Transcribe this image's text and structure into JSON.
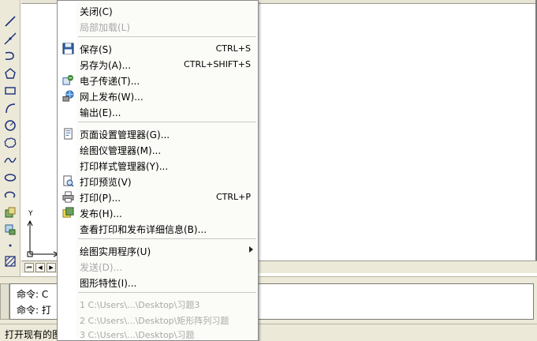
{
  "menu": {
    "items": [
      {
        "label": "关闭(C)",
        "shortcut": "",
        "icon": "",
        "disabled": false
      },
      {
        "label": "局部加载(L)",
        "shortcut": "",
        "icon": "",
        "disabled": true
      },
      {
        "label": "保存(S)",
        "shortcut": "CTRL+S",
        "icon": "floppy-disk-icon",
        "disabled": false
      },
      {
        "label": "另存为(A)...",
        "shortcut": "CTRL+SHIFT+S",
        "icon": "",
        "disabled": false
      },
      {
        "label": "电子传递(T)...",
        "shortcut": "",
        "icon": "etransmit-icon",
        "disabled": false
      },
      {
        "label": "网上发布(W)...",
        "shortcut": "",
        "icon": "publish-web-icon",
        "disabled": false
      },
      {
        "label": "输出(E)...",
        "shortcut": "",
        "icon": "",
        "disabled": false
      },
      {
        "label": "页面设置管理器(G)...",
        "shortcut": "",
        "icon": "page-setup-icon",
        "disabled": false
      },
      {
        "label": "绘图仪管理器(M)...",
        "shortcut": "",
        "icon": "",
        "disabled": false
      },
      {
        "label": "打印样式管理器(Y)...",
        "shortcut": "",
        "icon": "",
        "disabled": false
      },
      {
        "label": "打印预览(V)",
        "shortcut": "",
        "icon": "print-preview-icon",
        "disabled": false
      },
      {
        "label": "打印(P)...",
        "shortcut": "CTRL+P",
        "icon": "printer-icon",
        "disabled": false
      },
      {
        "label": "发布(H)...",
        "shortcut": "",
        "icon": "publish-icon",
        "disabled": false
      },
      {
        "label": "查看打印和发布详细信息(B)...",
        "shortcut": "",
        "icon": "",
        "disabled": false
      },
      {
        "label": "绘图实用程序(U)",
        "shortcut": "",
        "icon": "",
        "disabled": false,
        "submenu": true
      },
      {
        "label": "发送(D)...",
        "shortcut": "",
        "icon": "",
        "disabled": true
      },
      {
        "label": "图形特性(I)...",
        "shortcut": "",
        "icon": "",
        "disabled": false
      },
      {
        "label": "1 C:\\Users\\...\\Desktop\\习题3",
        "shortcut": "",
        "icon": "",
        "disabled": true
      },
      {
        "label": "2 C:\\Users\\...\\Desktop\\矩形阵列习题",
        "shortcut": "",
        "icon": "",
        "disabled": true
      },
      {
        "label": "3 C:\\Users\\...\\Desktop\\习题",
        "shortcut": "",
        "icon": "",
        "disabled": true
      }
    ]
  },
  "left_toolbar": {
    "tools": [
      "line-icon",
      "construction-line-icon",
      "polyline-icon",
      "polygon-icon",
      "rectangle-icon",
      "arc-icon",
      "circle-icon",
      "revision-cloud-icon",
      "spline-icon",
      "ellipse-icon",
      "ellipse-arc-icon",
      "insert-block-icon",
      "make-block-icon",
      "point-icon",
      "hatch-icon"
    ]
  },
  "canvas": {
    "ucs_y_label": "Y"
  },
  "command_window": {
    "line1": "命令: C",
    "line2": "命令: 打"
  },
  "status_bar": {
    "text": "打开现有的图"
  },
  "colors": {
    "menu_bg": "#fbfbf8",
    "toolbar_bg": "#ece9d8",
    "disabled_text": "#a8a8a8"
  }
}
